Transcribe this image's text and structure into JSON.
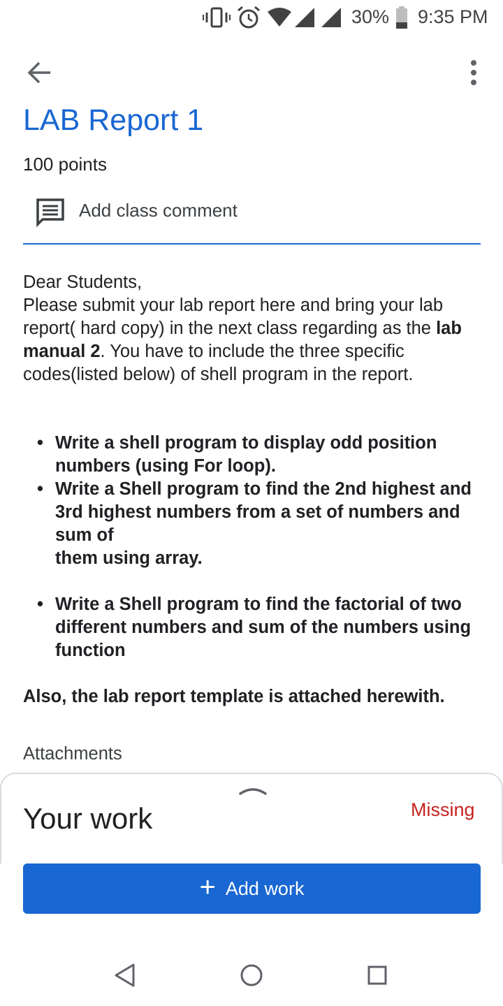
{
  "status_bar": {
    "icons": [
      "vibrate-icon",
      "alarm-icon",
      "wifi-icon",
      "signal-icon",
      "signal-icon",
      "battery-icon"
    ],
    "battery_percent": "30%",
    "time": "9:35 PM"
  },
  "app_bar": {
    "back_icon": "arrow-back-icon",
    "more_icon": "more-vert-icon"
  },
  "assignment": {
    "title": "LAB Report 1",
    "points": "100 points",
    "comment_label": "Add class comment",
    "comment_icon": "comment-icon"
  },
  "description": {
    "greeting": "Dear Students,",
    "para_before_bold": "Please submit your lab report here and bring your lab report( hard copy) in the next class regarding as the ",
    "para_bold": "lab manual 2",
    "para_after_bold": ". You have to include the three specific codes(listed below) of shell program in the report.",
    "bullets": [
      "Write a shell program to display odd position numbers (using For loop).",
      "Write a Shell program to find the 2nd highest and 3rd highest numbers from a set of numbers and sum of",
      "them using array.",
      "Write a Shell program to find the factorial of two different numbers and sum of the numbers using function"
    ],
    "closing": "Also, the lab report template is attached herewith."
  },
  "attachments_label": "Attachments",
  "your_work": {
    "title": "Your work",
    "status": "Missing",
    "status_color": "#c5221f",
    "add_work_label": "Add work",
    "add_work_icon": "plus-icon",
    "handle_icon": "chevron-up-icon"
  },
  "colors": {
    "accent": "#1967d2",
    "text": "#202124"
  },
  "nav_bar": {
    "icons": [
      "nav-back-icon",
      "nav-home-icon",
      "nav-recents-icon"
    ]
  }
}
